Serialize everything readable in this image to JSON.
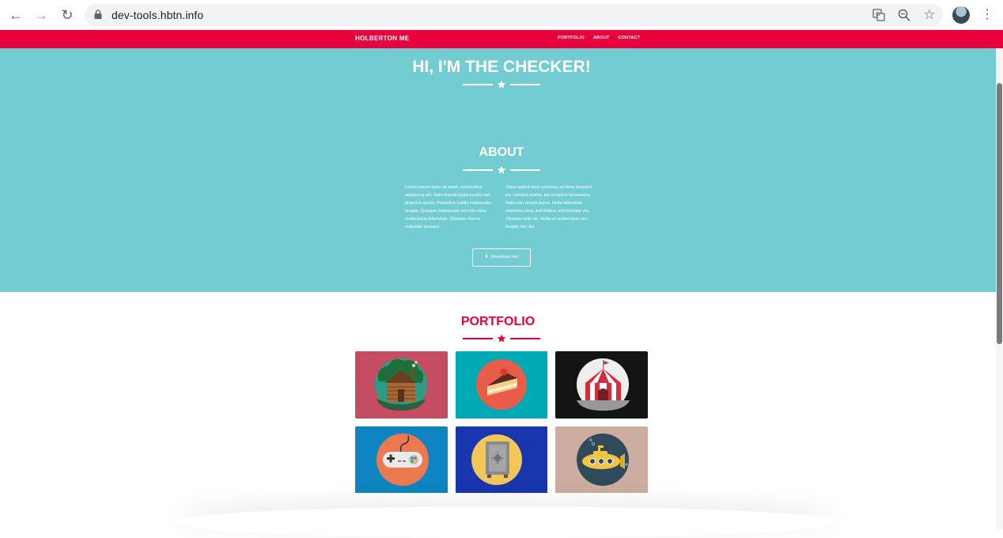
{
  "browser": {
    "url": "dev-tools.hbtn.info"
  },
  "nav": {
    "brand": "HOLBERTON ME",
    "links": [
      "PORTFOLIO",
      "ABOUT",
      "CONTACT"
    ],
    "color": "#e8003c"
  },
  "hero": {
    "heading": "HI, I'M THE CHECKER!",
    "background": "#72ccd2"
  },
  "about": {
    "heading": "ABOUT",
    "col1": "Lorem ipsum dolor sit amet, consectetur adipiscing elit. Nam blandit turpis iaculis nisl pharetra auctor. Phasellus mattis malesuada feugiat. Quisque malesuada orci non risus scelerisque bibendum. Quisque viverra vulputate posuere.",
    "col2": "Class aptent taciti sociosqu ad litora torquent per conubia nostra, per inceptos himenaeos. Nulla non ornare purus. Nulla bibendum maximus urna, sed finibus velit tristique vel. Vivamus ante mi, mollis at scelerisque nec, feugiat non dui.",
    "button": "Download me!"
  },
  "portfolio": {
    "heading": "PORTFOLIO",
    "items": [
      {
        "icon": "cabin-icon",
        "bg": "#c44d64"
      },
      {
        "icon": "cake-slice-icon",
        "bg": "#00aab5"
      },
      {
        "icon": "circus-tent-icon",
        "bg": "#141414"
      },
      {
        "icon": "game-controller-icon",
        "bg": "#0e85c0"
      },
      {
        "icon": "safe-icon",
        "bg": "#1a36ae"
      },
      {
        "icon": "submarine-icon",
        "bg": "#ccada0"
      }
    ]
  }
}
